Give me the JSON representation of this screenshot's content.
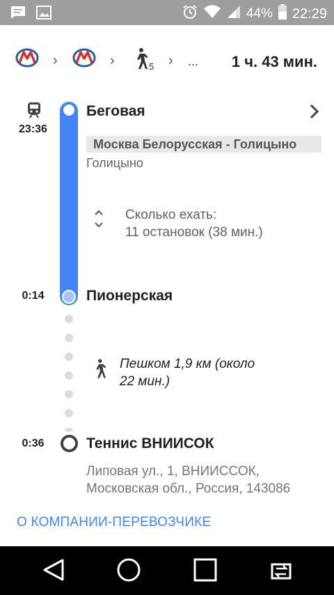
{
  "status_bar": {
    "battery": "44%",
    "time": "22:29",
    "icons": [
      "message-icon",
      "image-icon",
      "alarm-icon",
      "wifi-icon",
      "signal-icon",
      "battery-icon"
    ]
  },
  "route_header": {
    "walk_minutes": "5",
    "ellipsis": "...",
    "duration": "1 ч. 43 мин.",
    "icons": [
      "metro-icon",
      "metro-icon",
      "walk-icon"
    ]
  },
  "itinerary": {
    "departure_time": "23:36",
    "departure_stop": "Беговая",
    "route_name": "Москва Белорусская - Голицыно",
    "headsign": "Голицыно",
    "ride_label": "Сколько ехать:",
    "ride_stops": "11 остановок (38 мин.)",
    "arrival_time": "0:14",
    "arrival_stop": "Пионерская",
    "walk_line1": "Пешком 1,9 км (около",
    "walk_line2": "22 мин.)",
    "end_time": "0:36",
    "end_stop": "Теннис ВНИИСОК",
    "address_line1": "Липовая ул., 1, ВНИИССОК,",
    "address_line2": "Московская обл., Россия, 143086",
    "operator_link": "О КОМПАНИИ-ПЕРЕВОЗЧИКЕ",
    "accent_color": "#4285f4"
  }
}
